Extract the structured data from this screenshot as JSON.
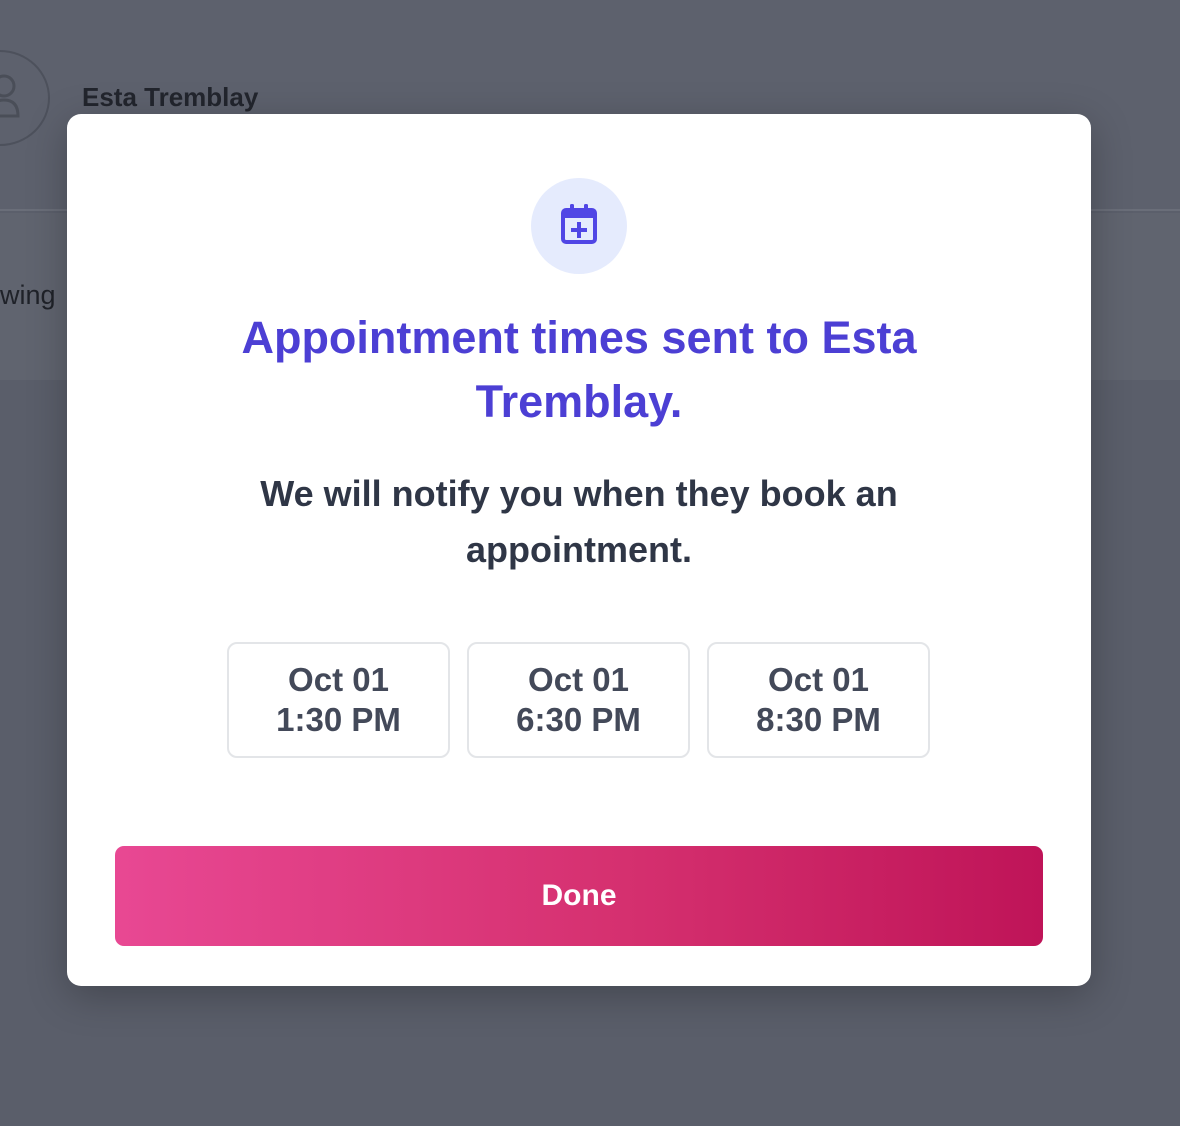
{
  "background": {
    "contact_name": "Esta Tremblay",
    "partial_label": "wing"
  },
  "modal": {
    "icon": "calendar-plus-icon",
    "title": "Appointment times sent to Esta Tremblay.",
    "subtitle": "We will notify you when they book an appointment.",
    "time_slots": [
      {
        "date": "Oct 01",
        "time": "1:30 PM"
      },
      {
        "date": "Oct 01",
        "time": "6:30 PM"
      },
      {
        "date": "Oct 01",
        "time": "8:30 PM"
      }
    ],
    "done_label": "Done"
  },
  "colors": {
    "accent_purple": "#4c3fd4",
    "button_gradient_start": "#e84893",
    "button_gradient_end": "#bf1458",
    "overlay": "#5b5f6b"
  }
}
